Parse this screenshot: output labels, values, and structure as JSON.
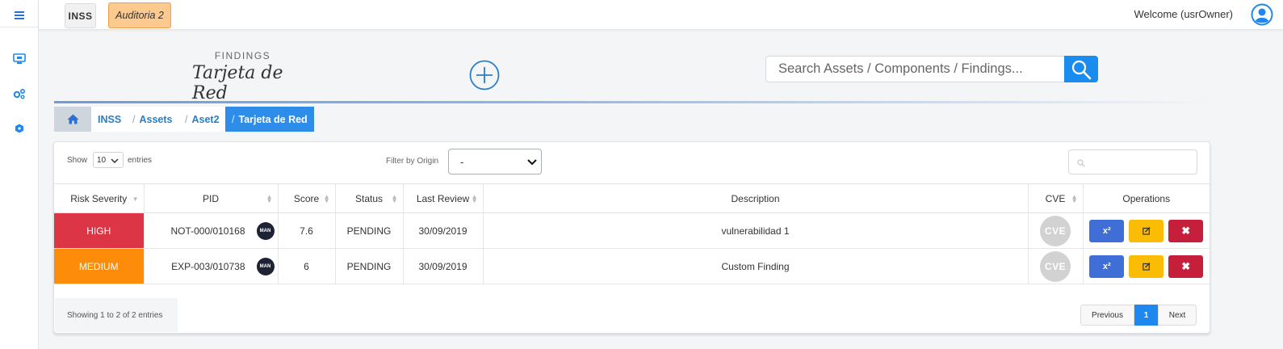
{
  "colors": {
    "accent_blue": "#1a8cf0",
    "high": "#dc3545",
    "medium": "#fd8c0a",
    "audit_chip": "#fcc98e"
  },
  "sidebar": {
    "items": [
      {
        "icon": "hamburger-menu-icon"
      },
      {
        "icon": "monitor-icon"
      },
      {
        "icon": "gears-icon"
      },
      {
        "icon": "cube-icon"
      }
    ]
  },
  "topbar": {
    "org_chip": "INSS",
    "audit_chip": "Auditoria 2",
    "welcome": "Welcome (usrOwner)"
  },
  "header": {
    "section": "FINDINGS",
    "title": "Tarjeta de Red"
  },
  "search": {
    "placeholder": "Search Assets / Components / Findings..."
  },
  "breadcrumb": {
    "separator": "/",
    "items": [
      {
        "label": "INSS"
      },
      {
        "label": "Assets"
      },
      {
        "label": "Aset2"
      },
      {
        "label": "Tarjeta de Red"
      }
    ]
  },
  "table_controls": {
    "show_label": "Show",
    "entries_value": "10",
    "entries_label": "entries",
    "filter_label": "Filter by Origin",
    "filter_value": "-"
  },
  "table": {
    "columns": [
      "Risk Severity",
      "PID",
      "Score",
      "Status",
      "Last Review",
      "Description",
      "CVE",
      "Operations"
    ],
    "rows": [
      {
        "severity": "HIGH",
        "severity_color": "#dc3545",
        "pid": "NOT-000/010168",
        "badge": "MAN",
        "score": "7.6",
        "status": "PENDING",
        "last_review": "30/09/2019",
        "description": "vulnerabilidad 1",
        "cve": "CVE"
      },
      {
        "severity": "MEDIUM",
        "severity_color": "#fd8c0a",
        "pid": "EXP-003/010738",
        "badge": "MAN",
        "score": "6",
        "status": "PENDING",
        "last_review": "30/09/2019",
        "description": "Custom Finding",
        "cve": "CVE"
      }
    ],
    "operations": {
      "first": "x²",
      "delete": "✖"
    }
  },
  "footer": {
    "info": "Showing 1 to 2 of 2 entries",
    "prev": "Previous",
    "page": "1",
    "next": "Next"
  }
}
